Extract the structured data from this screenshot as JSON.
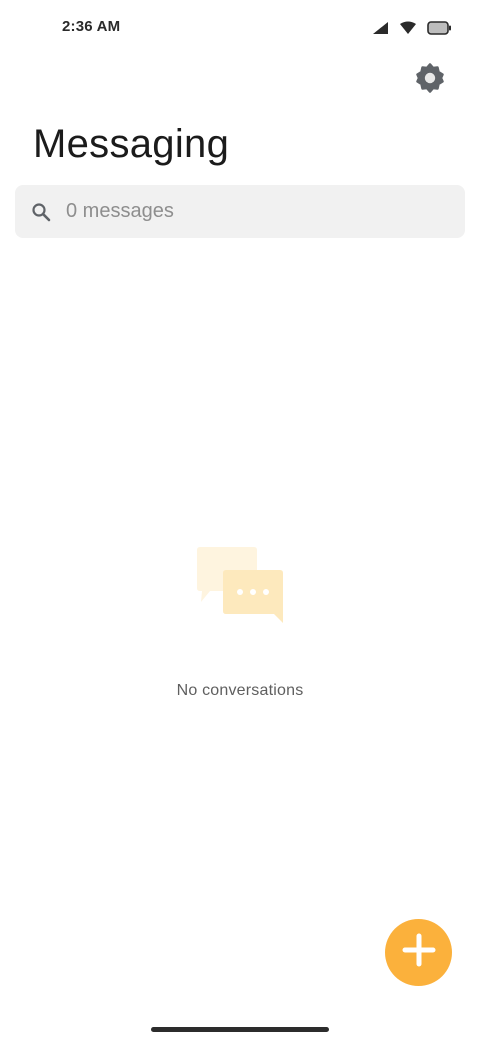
{
  "status_bar": {
    "time": "2:36 AM",
    "icons": [
      "signal-icon",
      "wifi-icon",
      "battery-icon"
    ]
  },
  "header": {
    "title": "Messaging",
    "settings_icon": "settings-gear-icon"
  },
  "search": {
    "placeholder": "0 messages",
    "value": "",
    "icon": "search-icon"
  },
  "empty_state": {
    "illustration_icon": "chat-bubbles-icon",
    "message": "No conversations"
  },
  "fab": {
    "icon": "plus-icon"
  },
  "colors": {
    "accent": "#fbb13c",
    "search_bg": "#f1f1f1",
    "illustration_light": "#fef4df",
    "illustration_mid": "#fde9bd"
  }
}
